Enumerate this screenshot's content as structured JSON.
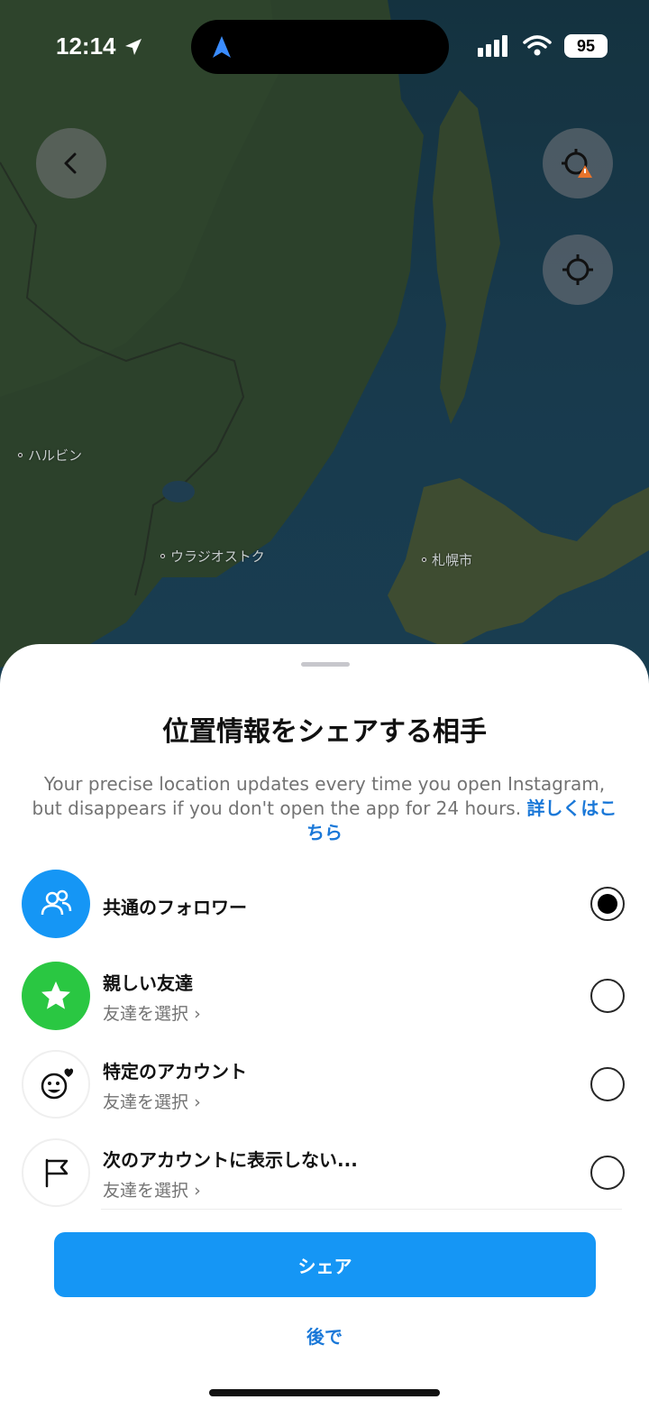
{
  "status_bar": {
    "time": "12:14",
    "battery": "95",
    "icons": [
      "location-arrow-icon",
      "signal-icon",
      "wifi-icon",
      "battery-icon"
    ]
  },
  "map": {
    "labels": [
      "ハルビン",
      "ウラジオストク",
      "札幌市"
    ],
    "buttons": [
      "back-icon",
      "location-warning-icon",
      "crosshair-icon"
    ]
  },
  "sheet": {
    "title": "位置情報をシェアする相手",
    "description": "Your precise location updates every time you open Instagram, but disappears if you don't open the app for 24 hours.",
    "learn_more": "詳しくはこちら",
    "options": [
      {
        "title": "共通のフォロワー",
        "subtitle": "",
        "icon": "people-icon",
        "selected": true
      },
      {
        "title": "親しい友達",
        "subtitle": "友達を選択",
        "icon": "star-icon",
        "selected": false
      },
      {
        "title": "特定のアカウント",
        "subtitle": "友達を選択",
        "icon": "face-heart-icon",
        "selected": false
      },
      {
        "title": "次のアカウントに表示しない...",
        "subtitle": "友達を選択",
        "icon": "flag-icon",
        "selected": false
      }
    ],
    "share_label": "シェア",
    "later_label": "後で"
  },
  "colors": {
    "accent": "#1596f5",
    "link": "#1a78d8",
    "close_friends": "#2ac742"
  }
}
